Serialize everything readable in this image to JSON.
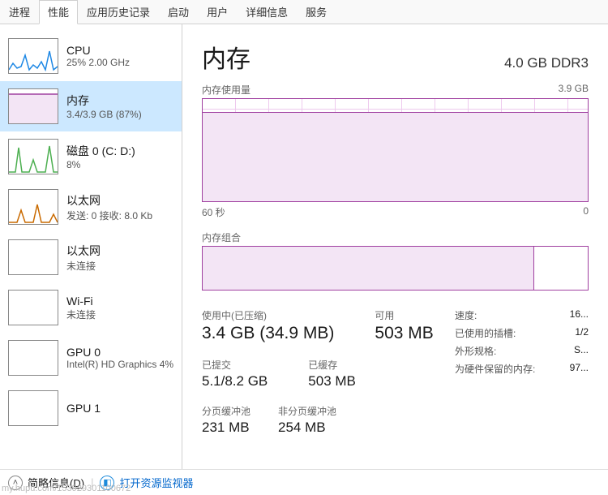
{
  "tabs": [
    "进程",
    "性能",
    "应用历史记录",
    "启动",
    "用户",
    "详细信息",
    "服务"
  ],
  "sidebar": [
    {
      "title": "CPU",
      "sub": "25% 2.00 GHz"
    },
    {
      "title": "内存",
      "sub": "3.4/3.9 GB (87%)"
    },
    {
      "title": "磁盘 0 (C: D:)",
      "sub": "8%"
    },
    {
      "title": "以太网",
      "sub": "发送: 0 接收: 8.0 Kb"
    },
    {
      "title": "以太网",
      "sub": "未连接"
    },
    {
      "title": "Wi-Fi",
      "sub": "未连接"
    },
    {
      "title": "GPU 0",
      "sub": "Intel(R) HD Graphics 4%"
    },
    {
      "title": "GPU 1",
      "sub": ""
    }
  ],
  "header": {
    "title": "内存",
    "right": "4.0 GB DDR3"
  },
  "chart_usage": {
    "label_left": "内存使用量",
    "label_right": "3.9 GB",
    "axis_left": "60 秒",
    "axis_right": "0"
  },
  "chart_comp": {
    "label": "内存组合"
  },
  "stats": {
    "inuse_label": "使用中(已压缩)",
    "inuse_val": "3.4 GB (34.9 MB)",
    "avail_label": "可用",
    "avail_val": "503 MB",
    "commit_label": "已提交",
    "commit_val": "5.1/8.2 GB",
    "cached_label": "已缓存",
    "cached_val": "503 MB",
    "paged_label": "分页缓冲池",
    "paged_val": "231 MB",
    "nonpaged_label": "非分页缓冲池",
    "nonpaged_val": "254 MB"
  },
  "props": {
    "speed_k": "速度:",
    "speed_v": "16...",
    "slots_k": "已使用的插槽:",
    "slots_v": "1/2",
    "form_k": "外形规格:",
    "form_v": "S...",
    "hw_k": "为硬件保留的内存:",
    "hw_v": "97..."
  },
  "footer": {
    "brief": "简略信息",
    "brief_key": "D",
    "open": "打开资源监视器"
  },
  "watermark": "my.hupu.com/153929301100672",
  "chart_data": {
    "type": "line",
    "title": "内存使用量",
    "ylabel": "GB",
    "ylim": [
      0,
      3.9
    ],
    "xlabel": "秒",
    "xlim": [
      60,
      0
    ],
    "series": [
      {
        "name": "使用中",
        "values": [
          3.4,
          3.4,
          3.4,
          3.4,
          3.4,
          3.4,
          3.4,
          3.4,
          3.4,
          3.4,
          3.4,
          3.4,
          3.4,
          3.4,
          3.4,
          3.4,
          3.4,
          3.4,
          3.4,
          3.4
        ]
      }
    ],
    "composition": {
      "in_use": 3.4,
      "modified": 0.0,
      "standby": 0.5,
      "free": 0.0,
      "total": 3.9
    }
  }
}
